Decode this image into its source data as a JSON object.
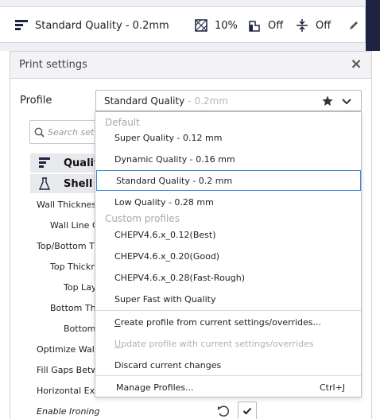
{
  "header": {
    "profile": "Standard Quality - 0.2mm",
    "infill": "10%",
    "support": "Off",
    "adhesion": "Off"
  },
  "panel": {
    "title": "Print settings",
    "profile_label": "Profile",
    "profile_value": "Standard Quality",
    "profile_value_sub": "- 0.2mm",
    "search_placeholder": "Search setti",
    "categories": [
      "Qualit",
      "Shell"
    ],
    "settings": [
      "Wall Thickness",
      "Wall Line C",
      "Top/Bottom Th",
      "Top Thickn",
      "Top Lay",
      "Bottom Th",
      "Bottom",
      "Optimize Wall",
      "Fill Gaps Betw",
      "Horizontal Exp",
      "Enable Ironing"
    ]
  },
  "dropdown": {
    "default_header": "Default",
    "default_items": [
      "Super Quality - 0.12 mm",
      "Dynamic Quality - 0.16 mm",
      "Standard Quality - 0.2 mm",
      "Low Quality - 0.28 mm"
    ],
    "custom_header": "Custom profiles",
    "custom_items": [
      "CHEPV4.6.x_0.12(Best)",
      "CHEPV4.6.x_0.20(Good)",
      "CHEPV4.6.x_0.28(Fast-Rough)",
      "Super Fast with Quality"
    ],
    "create_prefix": "C",
    "create_rest": "reate profile from current settings/overrides...",
    "update_prefix": "U",
    "update_rest": "pdate profile with current settings/overrides",
    "discard": "Discard current changes",
    "manage": "Manage Profiles...",
    "manage_shortcut": "Ctrl+J"
  },
  "colors": {
    "accent": "#3d83d8",
    "navy": "#1d2340"
  }
}
